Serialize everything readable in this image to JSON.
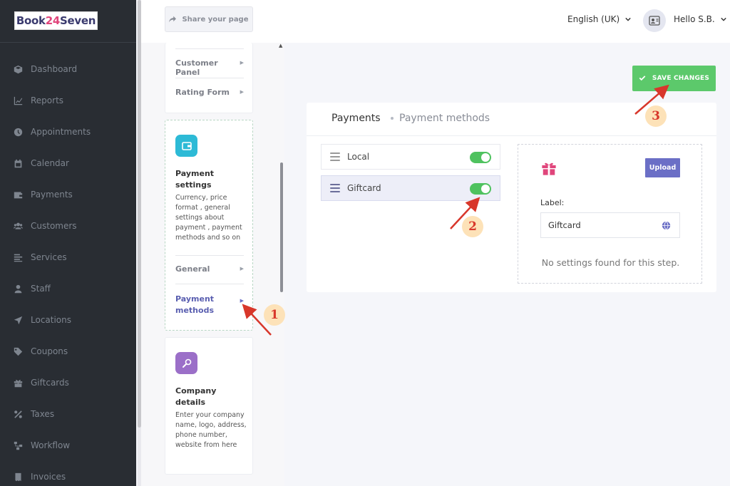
{
  "logo": {
    "part1": "Book",
    "part2": "24",
    "part3": "Seven"
  },
  "sidebar": {
    "items": [
      {
        "label": "Dashboard",
        "icon": "cube-icon"
      },
      {
        "label": "Reports",
        "icon": "chart-icon"
      },
      {
        "label": "Appointments",
        "icon": "clock-icon"
      },
      {
        "label": "Calendar",
        "icon": "calendar-icon"
      },
      {
        "label": "Payments",
        "icon": "wallet-icon"
      },
      {
        "label": "Customers",
        "icon": "users-icon"
      },
      {
        "label": "Services",
        "icon": "list-icon"
      },
      {
        "label": "Staff",
        "icon": "user-icon"
      },
      {
        "label": "Locations",
        "icon": "location-arrow-icon"
      },
      {
        "label": "Coupons",
        "icon": "tag-icon"
      },
      {
        "label": "Giftcards",
        "icon": "gift-icon"
      },
      {
        "label": "Taxes",
        "icon": "percent-icon"
      },
      {
        "label": "Workflow",
        "icon": "workflow-icon"
      },
      {
        "label": "Invoices",
        "icon": "invoice-icon"
      }
    ]
  },
  "topbar": {
    "share_label": "Share your page",
    "language": "English (UK)",
    "user_greeting": "Hello S.B."
  },
  "settings_column": {
    "card1": {
      "links": [
        {
          "label": "Customer Panel"
        },
        {
          "label": "Rating Form"
        }
      ]
    },
    "card2": {
      "title": "Payment settings",
      "description": "Currency, price format , general settings about payment , payment methods and so on",
      "links": [
        {
          "label": "General"
        },
        {
          "label": "Payment methods"
        }
      ]
    },
    "card3": {
      "title": "Company details",
      "description": "Enter your company name, logo, address, phone number, website from here"
    }
  },
  "main": {
    "save_label": "SAVE CHANGES",
    "breadcrumb_title": "Payments",
    "breadcrumb_sub": "Payment methods",
    "methods": [
      {
        "label": "Local",
        "enabled": true
      },
      {
        "label": "Giftcard",
        "enabled": true
      }
    ],
    "detail": {
      "upload_label": "Upload",
      "label_caption": "Label:",
      "label_value": "Giftcard",
      "empty_message": "No settings found for this step."
    }
  },
  "annotations": [
    "1",
    "2",
    "3"
  ],
  "colors": {
    "sidebar_bg": "#292d33",
    "save_green": "#5cc96b",
    "toggle_green": "#4fc25f",
    "upload_purple": "#6b6fc6",
    "annotation_red": "#d8372b"
  }
}
